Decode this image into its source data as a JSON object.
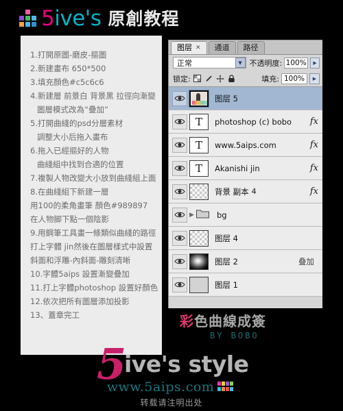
{
  "header": {
    "logo_five": "5",
    "logo_ive": "ive's",
    "title_cn": "原創教程",
    "pixel_colors": [
      "#f25ba8",
      "#8e4bd4",
      "#f2a23c",
      "#4fb8e8",
      "#3fbf5f",
      "#e8574f"
    ]
  },
  "tutorial": {
    "steps": [
      {
        "text": "1.打開原圖-磨皮-摳圖",
        "indent": false
      },
      {
        "text": "2.新建畫布 650*500",
        "indent": false
      },
      {
        "text": "3.填充顏色#c5c6c6",
        "indent": false
      },
      {
        "text": "4.新建層 前景白 背景黑 拉徑向漸變",
        "indent": false
      },
      {
        "text": "圖層模式改為“疊加”",
        "indent": true
      },
      {
        "text": "5.打開曲綫的psd分層素材",
        "indent": false
      },
      {
        "text": "調整大小后拖入畫布",
        "indent": true
      },
      {
        "text": "6.拖入已經摳好的人物",
        "indent": false
      },
      {
        "text": "曲綫組中找到合適的位置",
        "indent": true
      },
      {
        "text": "7.複製人物改變大小放到曲綫組上面",
        "indent": false
      },
      {
        "text": "8.在曲綫組下新建一層",
        "indent": false
      },
      {
        "text": "用100的柔角畫筆 顏色#989897",
        "indent": false
      },
      {
        "text": "在人物脚下點一個陰影",
        "indent": false
      },
      {
        "text": "9.用鋼筆工具畫一條類似曲綫的路徑",
        "indent": false
      },
      {
        "text": "打上字體 jin然後在圖層樣式中設置",
        "indent": false
      },
      {
        "text": "斜面和浮雕-內斜面-雕刻清晰",
        "indent": false
      },
      {
        "text": "10.字體5aips 設置漸變疊加",
        "indent": false
      },
      {
        "text": "11.打上字體photoshop 設置好顏色",
        "indent": false
      },
      {
        "text": "12.依次把所有圖層添加投影",
        "indent": false
      },
      {
        "text": "13、蓋章完工",
        "indent": false
      }
    ]
  },
  "layers_panel": {
    "tabs": [
      {
        "label": "图层",
        "active": true,
        "close": "✕"
      },
      {
        "label": "通道",
        "active": false,
        "close": ""
      },
      {
        "label": "路径",
        "active": false,
        "close": ""
      }
    ],
    "blend_mode": "正常",
    "opacity_label": "不透明度:",
    "opacity_value": "100%",
    "lock_label": "锁定:",
    "fill_label": "填充:",
    "fill_value": "100%",
    "lock_icons": [
      "lock-transparent-pixels-icon",
      "lock-image-pixels-icon",
      "lock-position-icon",
      "lock-all-icon"
    ],
    "layers": [
      {
        "name": "图层 5",
        "suffix": "",
        "thumb": "photo",
        "selected": true,
        "fx": "",
        "mode": "",
        "type": "image"
      },
      {
        "name": "photoshop (c) bobo",
        "suffix": "",
        "thumb": "text",
        "selected": false,
        "fx": "fx",
        "mode": "",
        "type": "text"
      },
      {
        "name": "www.5aips.com",
        "suffix": "",
        "thumb": "text",
        "selected": false,
        "fx": "fx",
        "mode": "",
        "type": "text"
      },
      {
        "name": "Akanishi jin",
        "suffix": "",
        "thumb": "text",
        "selected": false,
        "fx": "fx",
        "mode": "",
        "type": "text"
      },
      {
        "name": "背景 副本",
        "suffix": "4",
        "thumb": "checker",
        "selected": false,
        "fx": "fx",
        "mode": "",
        "type": "image"
      },
      {
        "name": "bg",
        "suffix": "",
        "thumb": "group",
        "selected": false,
        "fx": "",
        "mode": "",
        "type": "group"
      },
      {
        "name": "图层 4",
        "suffix": "",
        "thumb": "checker",
        "selected": false,
        "fx": "",
        "mode": "",
        "type": "image"
      },
      {
        "name": "图层 2",
        "suffix": "",
        "thumb": "radial",
        "selected": false,
        "fx": "",
        "mode": "叠加",
        "type": "image"
      },
      {
        "name": "图层 1",
        "suffix": "",
        "thumb": "flat",
        "selected": false,
        "fx": "",
        "mode": "",
        "type": "image"
      }
    ]
  },
  "caption": {
    "pink_part": "彩",
    "gray_part": "色曲線成簽",
    "byline": "BY BOBO"
  },
  "footer": {
    "logo_five": "5",
    "logo_ive_style": "ive's style",
    "url": "www.5aips.com",
    "note": "转载请注明出处",
    "grid_colors": [
      "#e33e9e",
      "#f4d03f",
      "#f08a3c",
      "#9b59d0",
      "#8fd14f",
      "#e8574f",
      "#f4d03f",
      "#4fb8e8",
      "#3fb8e0",
      "#f28c3c"
    ]
  }
}
